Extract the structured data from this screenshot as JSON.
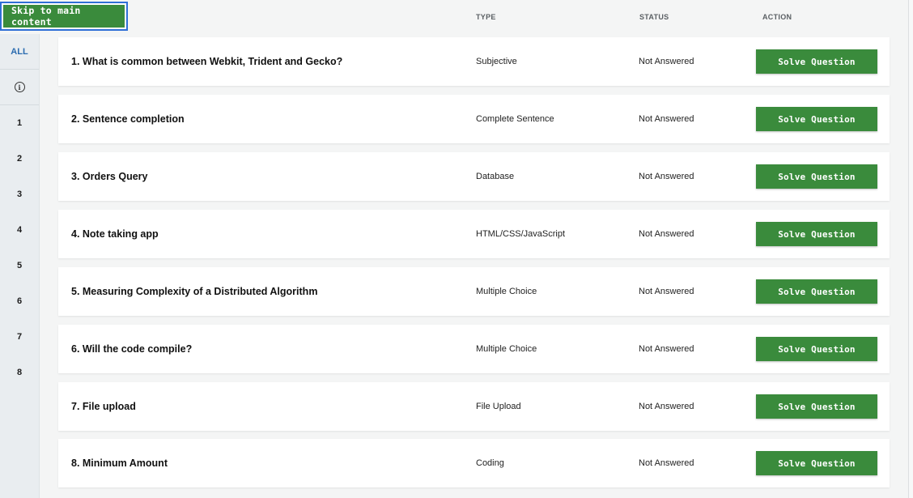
{
  "skip_link": {
    "label": "Skip to main content"
  },
  "sidebar": {
    "items": [
      "ALL",
      "1",
      "2",
      "3",
      "4",
      "5",
      "6",
      "7",
      "8"
    ]
  },
  "header": {
    "type": "TYPE",
    "status": "STATUS",
    "action": "ACTION"
  },
  "questions": [
    {
      "title": "1. What is common between Webkit, Trident and Gecko?",
      "type": "Subjective",
      "status": "Not Answered",
      "action": "Solve Question"
    },
    {
      "title": "2. Sentence completion",
      "type": "Complete Sentence",
      "status": "Not Answered",
      "action": "Solve Question"
    },
    {
      "title": "3. Orders Query",
      "type": "Database",
      "status": "Not Answered",
      "action": "Solve Question"
    },
    {
      "title": "4. Note taking app",
      "type": "HTML/CSS/JavaScript",
      "status": "Not Answered",
      "action": "Solve Question"
    },
    {
      "title": "5. Measuring Complexity of a Distributed Algorithm",
      "type": "Multiple Choice",
      "status": "Not Answered",
      "action": "Solve Question"
    },
    {
      "title": "6. Will the code compile?",
      "type": "Multiple Choice",
      "status": "Not Answered",
      "action": "Solve Question"
    },
    {
      "title": "7. File upload",
      "type": "File Upload",
      "status": "Not Answered",
      "action": "Solve Question"
    },
    {
      "title": "8. Minimum Amount",
      "type": "Coding",
      "status": "Not Answered",
      "action": "Solve Question"
    }
  ],
  "icons": {
    "info": "info-icon"
  },
  "colors": {
    "accent": "#3a8b3c",
    "link": "#2b6cb0",
    "focus": "#2f6fd6"
  }
}
